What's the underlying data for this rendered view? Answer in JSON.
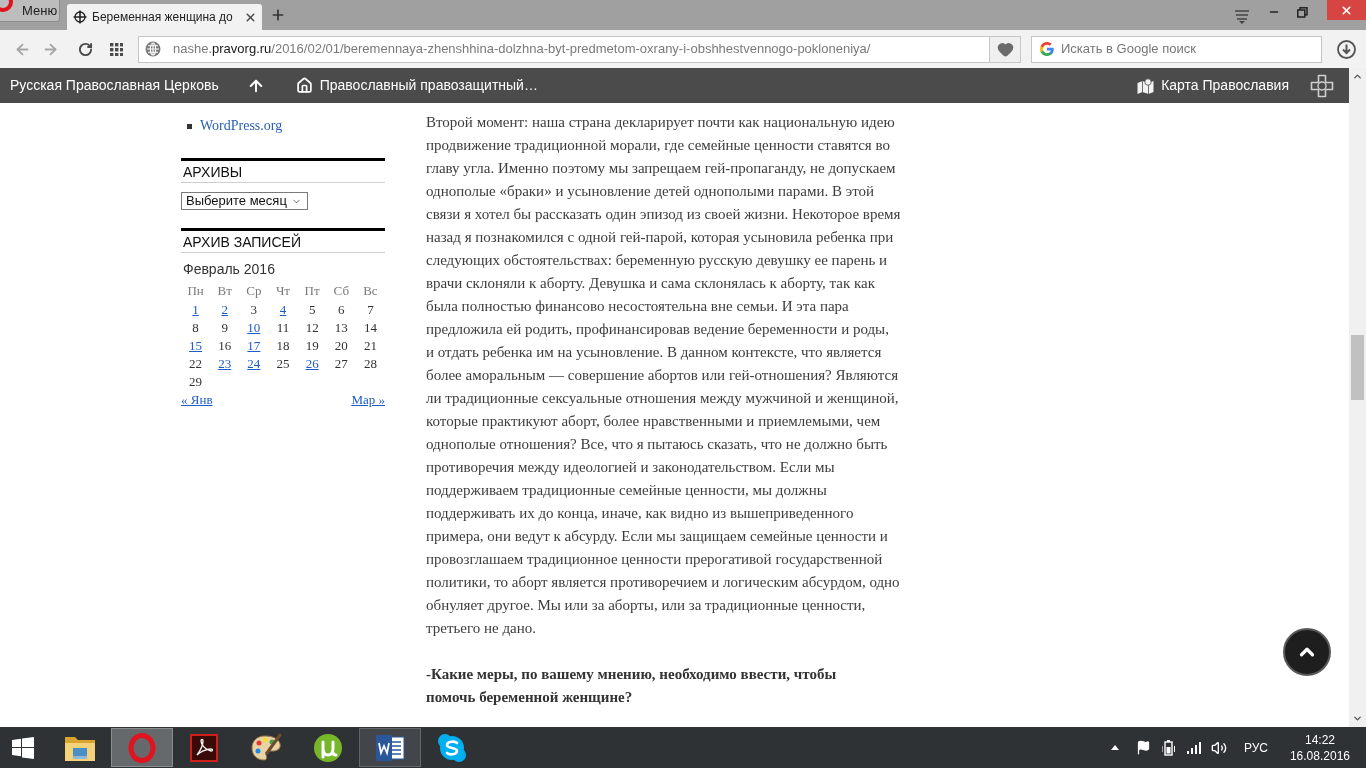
{
  "browser": {
    "menu_label": "Меню",
    "tabs": [
      {
        "title": "Беременная женщина до",
        "selected": true
      }
    ],
    "address": {
      "subdomain": "nashe.",
      "domain": "pravorg.ru",
      "path": "/2016/02/01/beremennaya-zhenshhina-dolzhna-byt-predmetom-oxrany-i-obshhestvennogo-pokloneniya/"
    },
    "search": {
      "placeholder": "Искать в Google поиск"
    }
  },
  "site_bar": {
    "site_name": "Русская Православная Церковь",
    "home_link": "Православный правозащитный…",
    "map_link": "Карта Православия"
  },
  "sidebar": {
    "links": [
      "WordPress.org"
    ],
    "archives": {
      "title": "АРХИВЫ",
      "select": "Выберите месяц"
    },
    "calendar": {
      "title": "АРХИВ ЗАПИСЕЙ",
      "caption": "Февраль 2016",
      "weekdays": [
        "Пн",
        "Вт",
        "Ср",
        "Чт",
        "Пт",
        "Сб",
        "Вс"
      ],
      "weeks": [
        [
          {
            "day": "1",
            "linked": true
          },
          {
            "day": "2",
            "linked": true
          },
          {
            "day": "3",
            "linked": false
          },
          {
            "day": "4",
            "linked": true
          },
          {
            "day": "5",
            "linked": false
          },
          {
            "day": "6",
            "linked": false
          },
          {
            "day": "7",
            "linked": false
          }
        ],
        [
          {
            "day": "8",
            "linked": false
          },
          {
            "day": "9",
            "linked": false
          },
          {
            "day": "10",
            "linked": true
          },
          {
            "day": "11",
            "linked": false
          },
          {
            "day": "12",
            "linked": false
          },
          {
            "day": "13",
            "linked": false
          },
          {
            "day": "14",
            "linked": false
          }
        ],
        [
          {
            "day": "15",
            "linked": true
          },
          {
            "day": "16",
            "linked": false
          },
          {
            "day": "17",
            "linked": true
          },
          {
            "day": "18",
            "linked": false
          },
          {
            "day": "19",
            "linked": false
          },
          {
            "day": "20",
            "linked": false
          },
          {
            "day": "21",
            "linked": false
          }
        ],
        [
          {
            "day": "22",
            "linked": false
          },
          {
            "day": "23",
            "linked": true
          },
          {
            "day": "24",
            "linked": true
          },
          {
            "day": "25",
            "linked": false
          },
          {
            "day": "26",
            "linked": true
          },
          {
            "day": "27",
            "linked": false
          },
          {
            "day": "28",
            "linked": false
          }
        ],
        [
          {
            "day": "29",
            "linked": false
          }
        ]
      ],
      "prev": "« Янв",
      "next": "Мар »"
    }
  },
  "article": {
    "paragraphs": [
      {
        "kind": "text",
        "lines": [
          "Второй момент: наша страна декларирует почти как национальную идею",
          "продвижение традиционной морали, где семейные ценности ставятся во",
          "главу угла. Именно поэтому мы запрещаем гей-пропаганду, не допускаем",
          "однополые «браки» и усыновление детей однополыми парами. В этой",
          "связи я хотел бы рассказать один эпизод из своей жизни. Некоторое время",
          "назад я познакомился с одной гей-парой, которая усыновила ребенка при",
          "следующих обстоятельствах: беременную русскую девушку ее парень и",
          "врачи склоняли к аборту. Девушка и сама склонялась к аборту, так как",
          "была полностью финансово несостоятельна вне семьи. И эта пара",
          "предложила ей родить, профинансировав ведение беременности и роды,",
          "и отдать ребенка им на усыновление. В данном контексте, что является",
          "более аморальным — совершение абортов или гей-отношения? Являются",
          "ли традиционные сексуальные отношения между мужчиной и женщиной,",
          "которые практикуют аборт, более нравственными и приемлемыми, чем",
          "однополые отношения? Все, что я пытаюсь сказать, что не должно быть",
          "противоречия между идеологией и законодательством. Если мы",
          "поддерживаем традиционные семейные ценности, мы должны",
          "поддерживать их до конца, иначе, как видно из вышеприведенного",
          "примера, они ведут к абсурду. Если мы защищаем семейные ценности и",
          "провозглашаем традиционное ценности прерогативой государственной",
          "политики, то аборт является противоречием и логическим абсурдом, одно",
          "обнуляет другое. Мы или за аборты, или за традиционные ценности,",
          "третьего не дано."
        ]
      },
      {
        "kind": "question",
        "lines": [
          "-Какие меры, по вашему мнению, необходимо ввести, чтобы",
          "помочь беременной женщине?"
        ]
      }
    ]
  },
  "taskbar": {
    "apps": [
      {
        "kind": "folder",
        "active": false,
        "running": false
      },
      {
        "kind": "ring",
        "active": true,
        "running": true
      },
      {
        "kind": "pdf",
        "active": false,
        "running": false
      },
      {
        "kind": "palette",
        "active": false,
        "running": false
      },
      {
        "kind": "torrent",
        "active": false,
        "running": false
      },
      {
        "kind": "word",
        "active": false,
        "running": true
      },
      {
        "kind": "chat",
        "active": false,
        "running": false
      }
    ],
    "tray": {
      "language": "РУС",
      "time": "14:22",
      "date": "16.08.2016"
    }
  }
}
